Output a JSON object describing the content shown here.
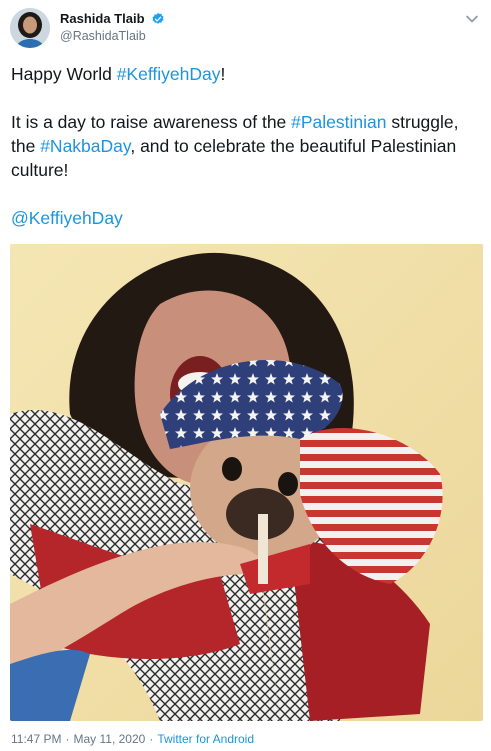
{
  "author": {
    "display_name": "Rashida Tlaib",
    "handle": "@RashidaTlaib",
    "verified": true
  },
  "tweet": {
    "line1_prefix": "Happy World ",
    "line1_hashtag": "#KeffiyehDay",
    "line1_suffix": "!",
    "p2_a": "It is a day to raise awareness of the ",
    "p2_hashtag1": "#Palestinian",
    "p2_b": " struggle, the ",
    "p2_hashtag2": "#NakbaDay",
    "p2_c": ", and to celebrate the beautiful Palestinian culture!",
    "mention": "@KeffiyehDay"
  },
  "footer": {
    "time": "11:47 PM",
    "separator": "·",
    "date": "May 11, 2020",
    "source": "Twitter for Android"
  },
  "colors": {
    "link": "#1b95e0",
    "muted": "#657786",
    "text": "#14171a",
    "verified": "#1da1f2"
  },
  "icons": {
    "verified": "verified-badge-icon",
    "menu": "chevron-down-icon"
  }
}
